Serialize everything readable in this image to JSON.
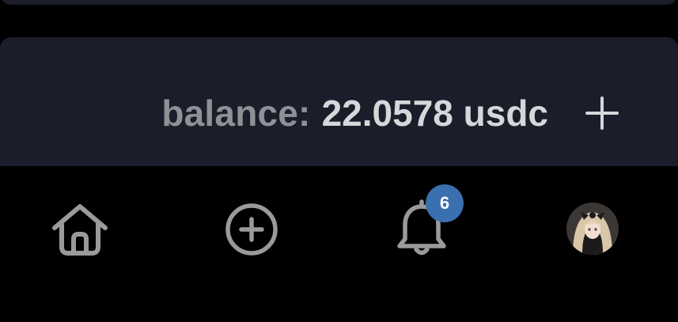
{
  "balance": {
    "label": "balance:",
    "amount": "22.0578 usdc",
    "add_icon": "plus-icon"
  },
  "nav": {
    "home_icon": "home-icon",
    "create_icon": "plus-circle-icon",
    "notifications_icon": "bell-icon",
    "notification_count": "6",
    "profile_icon": "avatar"
  },
  "colors": {
    "background": "#000000",
    "card": "#1b1d2a",
    "label_text": "#8f9196",
    "value_text": "#d6d7da",
    "icon": "#9a9a9c",
    "badge": "#3a6fb0"
  }
}
